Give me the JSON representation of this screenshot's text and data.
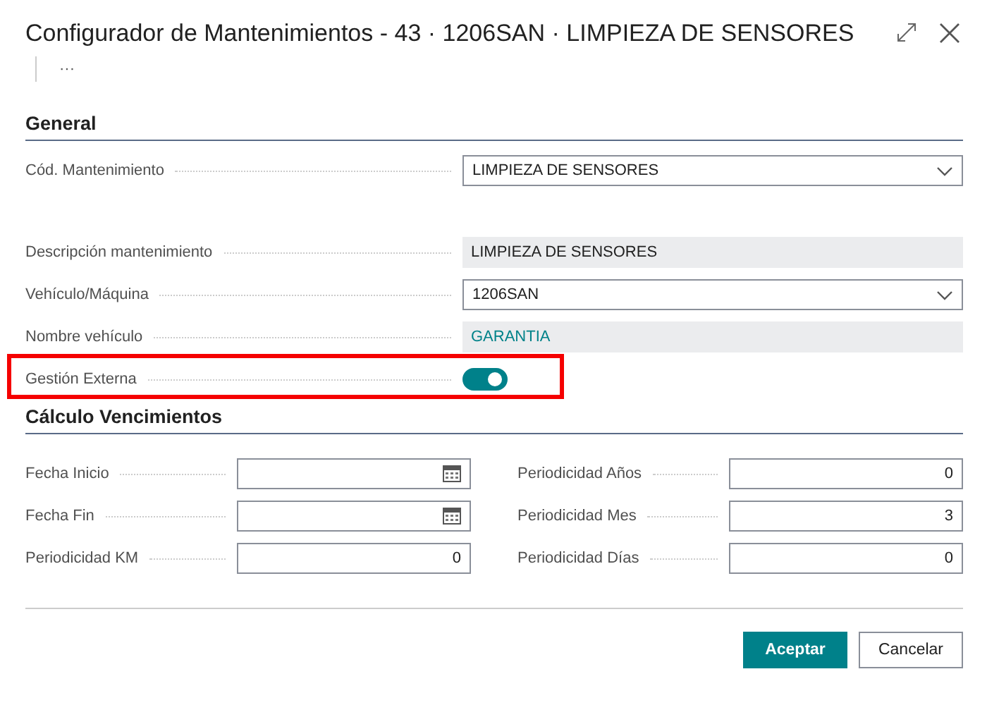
{
  "window": {
    "title": "Configurador de Mantenimientos - 43 · 1206SAN · LIMPIEZA DE SENSORES",
    "more": "···"
  },
  "general": {
    "title": "General",
    "groups": [
      [
        {
          "label": "Cód. Mantenimiento",
          "kind": "dropdown",
          "value": "LIMPIEZA DE SENSORES"
        }
      ],
      [
        {
          "label": "Descripción mantenimiento",
          "kind": "readonly",
          "value": "LIMPIEZA DE SENSORES",
          "link": false
        },
        {
          "label": "Vehículo/Máquina",
          "kind": "dropdown",
          "value": "1206SAN"
        },
        {
          "label": "Nombre vehículo",
          "kind": "readonly",
          "value": "GARANTIA",
          "link": true
        },
        {
          "label": "Gestión Externa",
          "kind": "toggle",
          "on": true,
          "highlighted": true
        }
      ]
    ]
  },
  "vencimientos": {
    "title": "Cálculo Vencimientos",
    "columns": [
      [
        {
          "label": "Fecha Inicio",
          "kind": "date"
        },
        {
          "label": "Fecha Fin",
          "kind": "date"
        },
        {
          "label": "Periodicidad KM",
          "kind": "number",
          "value": "0"
        }
      ],
      [
        {
          "label": "Periodicidad Años",
          "kind": "number",
          "value": "0"
        },
        {
          "label": "Periodicidad Mes",
          "kind": "number",
          "value": "3"
        },
        {
          "label": "Periodicidad Días",
          "kind": "number",
          "value": "0"
        }
      ]
    ]
  },
  "buttons": [
    {
      "label": "Aceptar",
      "primary": true
    },
    {
      "label": "Cancelar",
      "primary": false
    }
  ]
}
